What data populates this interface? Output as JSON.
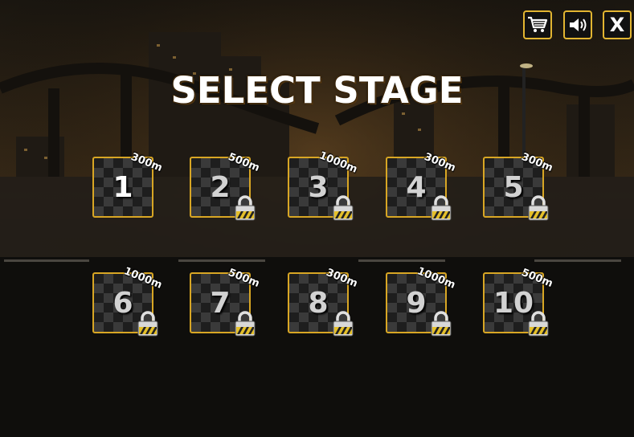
{
  "title": "SELECT STAGE",
  "buttons": {
    "shop": "cart-icon",
    "sound": "speaker-icon",
    "close": "X"
  },
  "colors": {
    "accent": "#d8a624",
    "title_outline": "#5a3a10"
  },
  "stages": [
    {
      "number": "1",
      "distance": "300m",
      "locked": false
    },
    {
      "number": "2",
      "distance": "500m",
      "locked": true
    },
    {
      "number": "3",
      "distance": "1000m",
      "locked": true
    },
    {
      "number": "4",
      "distance": "300m",
      "locked": true
    },
    {
      "number": "5",
      "distance": "300m",
      "locked": true
    },
    {
      "number": "6",
      "distance": "1000m",
      "locked": true
    },
    {
      "number": "7",
      "distance": "500m",
      "locked": true
    },
    {
      "number": "8",
      "distance": "300m",
      "locked": true
    },
    {
      "number": "9",
      "distance": "1000m",
      "locked": true
    },
    {
      "number": "10",
      "distance": "500m",
      "locked": true
    }
  ]
}
